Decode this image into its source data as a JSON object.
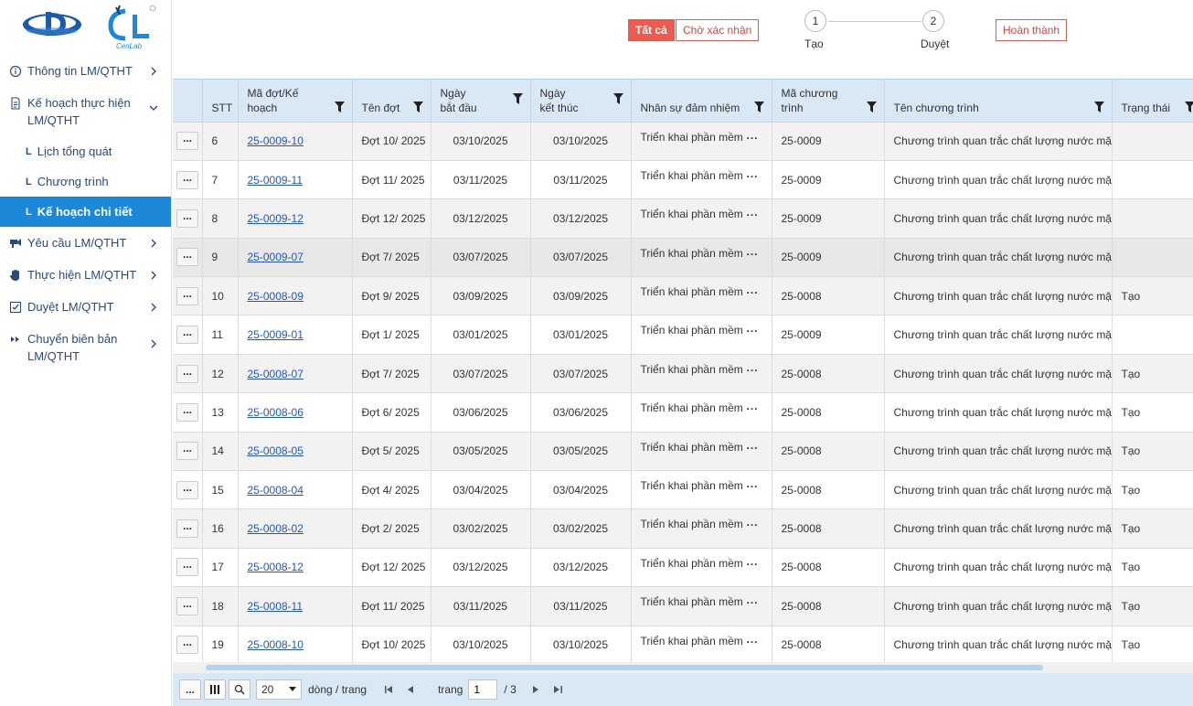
{
  "colors": {
    "accent": "#1e88d8",
    "danger": "#ec5b50",
    "header_bg": "#d8e8f4",
    "link": "#2255cc",
    "menu_text": "#2a4a7a"
  },
  "brand": {
    "logo_sub": "CenLab"
  },
  "sidebar": {
    "items": [
      {
        "label": "Thông tin LM/QTHT",
        "icon": "info-circle-icon"
      },
      {
        "label": "Kế hoạch thực hiện LM/QTHT",
        "icon": "document-icon",
        "expanded": true
      },
      {
        "label": "Yêu cầu LM/QTHT",
        "icon": "request-icon"
      },
      {
        "label": "Thực hiện LM/QTHT",
        "icon": "hand-icon"
      },
      {
        "label": "Duyệt LM/QTHT",
        "icon": "approve-icon"
      },
      {
        "label": "Chuyển biên bản LM/QTHT",
        "icon": "forward-icon"
      }
    ],
    "subitems": [
      {
        "label": "Lịch tổng quát",
        "mark": "L"
      },
      {
        "label": "Chương trình",
        "mark": "L"
      },
      {
        "label": "Kế hoạch chi tiết",
        "mark": "L",
        "active": true
      }
    ]
  },
  "toolbar": {
    "filter_all": "Tất cả",
    "filter_pending": "Chờ xác nhận",
    "filter_done": "Hoàn thành",
    "steps": [
      {
        "num": "1",
        "label": "Tạo"
      },
      {
        "num": "2",
        "label": "Duyệt"
      }
    ]
  },
  "table": {
    "headers": {
      "stt": "STT",
      "code": "Mã đợt/Kế hoạch",
      "name": "Tên đợt",
      "start": "Ngày bắt đầu",
      "end": "Ngày kết thúc",
      "staff": "Nhân sự đảm nhiệm",
      "program_code": "Mã chương trình",
      "program_name": "Tên chương trình",
      "status": "Trạng thái"
    },
    "row_menu": "...",
    "staff_more": "...",
    "rows": [
      {
        "stt": "6",
        "code": "25-0009-10",
        "name": "Đợt 10/ 2025",
        "start": "03/10/2025",
        "end": "03/10/2025",
        "staff": "Triển khai phần mềm",
        "program_code": "25-0009",
        "program_name": "Chương trình quan trắc chất lượng nước mặt",
        "status": ""
      },
      {
        "stt": "7",
        "code": "25-0009-11",
        "name": "Đợt 11/ 2025",
        "start": "03/11/2025",
        "end": "03/11/2025",
        "staff": "Triển khai phần mềm",
        "program_code": "25-0009",
        "program_name": "Chương trình quan trắc chất lượng nước mặt",
        "status": ""
      },
      {
        "stt": "8",
        "code": "25-0009-12",
        "name": "Đợt 12/ 2025",
        "start": "03/12/2025",
        "end": "03/12/2025",
        "staff": "Triển khai phần mềm",
        "program_code": "25-0009",
        "program_name": "Chương trình quan trắc chất lượng nước mặt",
        "status": ""
      },
      {
        "stt": "9",
        "code": "25-0009-07",
        "name": "Đợt 7/ 2025",
        "start": "03/07/2025",
        "end": "03/07/2025",
        "staff": "Triển khai phần mềm",
        "program_code": "25-0009",
        "program_name": "Chương trình quan trắc chất lượng nước mặt",
        "status": ""
      },
      {
        "stt": "10",
        "code": "25-0008-09",
        "name": "Đợt 9/ 2025",
        "start": "03/09/2025",
        "end": "03/09/2025",
        "staff": "Triển khai phần mềm",
        "program_code": "25-0008",
        "program_name": "Chương trình quan trắc chất lượng nước mặt",
        "status": "Tạo"
      },
      {
        "stt": "11",
        "code": "25-0009-01",
        "name": "Đợt 1/ 2025",
        "start": "03/01/2025",
        "end": "03/01/2025",
        "staff": "Triển khai phần mềm",
        "program_code": "25-0009",
        "program_name": "Chương trình quan trắc chất lượng nước mặt",
        "status": ""
      },
      {
        "stt": "12",
        "code": "25-0008-07",
        "name": "Đợt 7/ 2025",
        "start": "03/07/2025",
        "end": "03/07/2025",
        "staff": "Triển khai phần mềm",
        "program_code": "25-0008",
        "program_name": "Chương trình quan trắc chất lượng nước mặt",
        "status": "Tạo"
      },
      {
        "stt": "13",
        "code": "25-0008-06",
        "name": "Đợt 6/ 2025",
        "start": "03/06/2025",
        "end": "03/06/2025",
        "staff": "Triển khai phần mềm",
        "program_code": "25-0008",
        "program_name": "Chương trình quan trắc chất lượng nước mặt",
        "status": "Tạo"
      },
      {
        "stt": "14",
        "code": "25-0008-05",
        "name": "Đợt 5/ 2025",
        "start": "03/05/2025",
        "end": "03/05/2025",
        "staff": "Triển khai phần mềm",
        "program_code": "25-0008",
        "program_name": "Chương trình quan trắc chất lượng nước mặt",
        "status": "Tạo"
      },
      {
        "stt": "15",
        "code": "25-0008-04",
        "name": "Đợt 4/ 2025",
        "start": "03/04/2025",
        "end": "03/04/2025",
        "staff": "Triển khai phần mềm",
        "program_code": "25-0008",
        "program_name": "Chương trình quan trắc chất lượng nước mặt",
        "status": "Tạo"
      },
      {
        "stt": "16",
        "code": "25-0008-02",
        "name": "Đợt 2/ 2025",
        "start": "03/02/2025",
        "end": "03/02/2025",
        "staff": "Triển khai phần mềm",
        "program_code": "25-0008",
        "program_name": "Chương trình quan trắc chất lượng nước mặt",
        "status": "Tạo"
      },
      {
        "stt": "17",
        "code": "25-0008-12",
        "name": "Đợt 12/ 2025",
        "start": "03/12/2025",
        "end": "03/12/2025",
        "staff": "Triển khai phần mềm",
        "program_code": "25-0008",
        "program_name": "Chương trình quan trắc chất lượng nước mặt",
        "status": "Tạo"
      },
      {
        "stt": "18",
        "code": "25-0008-11",
        "name": "Đợt 11/ 2025",
        "start": "03/11/2025",
        "end": "03/11/2025",
        "staff": "Triển khai phần mềm",
        "program_code": "25-0008",
        "program_name": "Chương trình quan trắc chất lượng nước mặt",
        "status": "Tạo"
      },
      {
        "stt": "19",
        "code": "25-0008-10",
        "name": "Đợt 10/ 2025",
        "start": "03/10/2025",
        "end": "03/10/2025",
        "staff": "Triển khai phần mềm",
        "program_code": "25-0008",
        "program_name": "Chương trình quan trắc chất lượng nước mặt",
        "status": "Tạo"
      }
    ]
  },
  "pager": {
    "more": "...",
    "page_size": "20",
    "rows_per_page": "dòng / trang",
    "page_label": "trang",
    "current_page": "1",
    "total_pages": "/ 3"
  }
}
